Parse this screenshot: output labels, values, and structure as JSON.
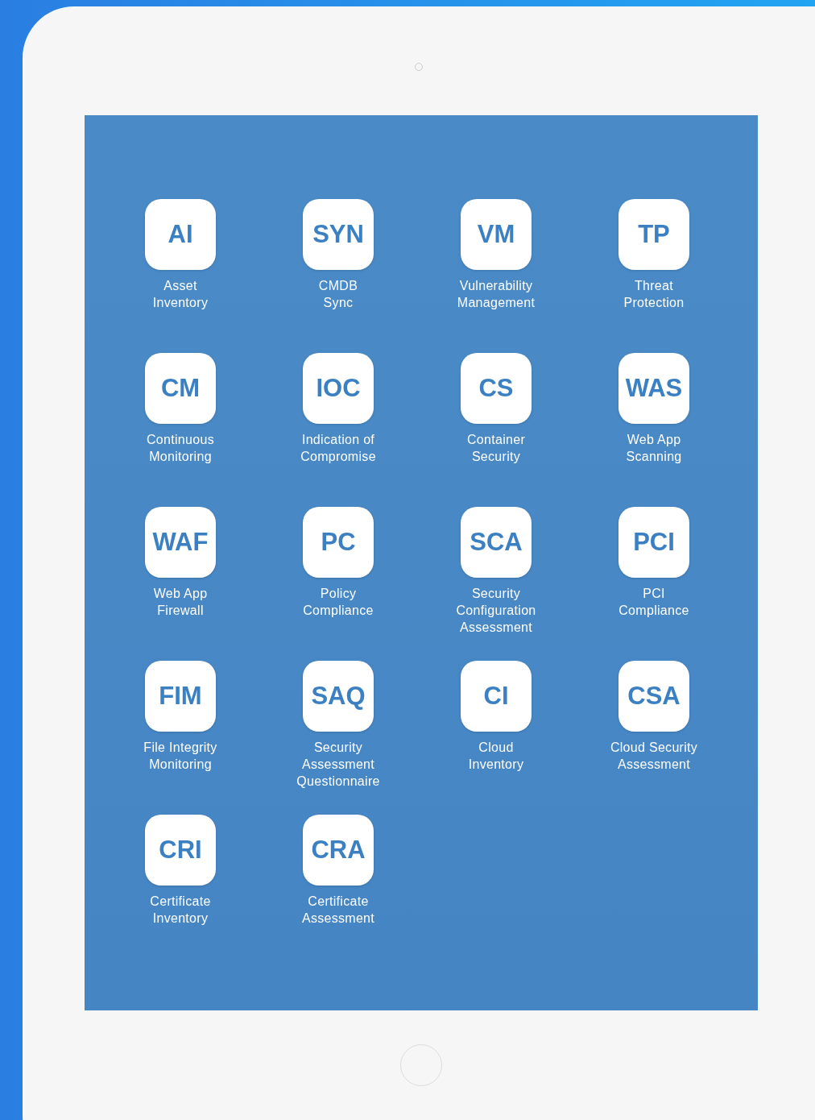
{
  "apps": [
    {
      "abbr": "AI",
      "label": "Asset\nInventory"
    },
    {
      "abbr": "SYN",
      "label": "CMDB\nSync"
    },
    {
      "abbr": "VM",
      "label": "Vulnerability\nManagement"
    },
    {
      "abbr": "TP",
      "label": "Threat\nProtection"
    },
    {
      "abbr": "CM",
      "label": "Continuous\nMonitoring"
    },
    {
      "abbr": "IOC",
      "label": "Indication of\nCompromise"
    },
    {
      "abbr": "CS",
      "label": "Container\nSecurity"
    },
    {
      "abbr": "WAS",
      "label": "Web App\nScanning"
    },
    {
      "abbr": "WAF",
      "label": "Web App\nFirewall"
    },
    {
      "abbr": "PC",
      "label": "Policy\nCompliance"
    },
    {
      "abbr": "SCA",
      "label": "Security\nConfiguration\nAssessment"
    },
    {
      "abbr": "PCI",
      "label": "PCI\nCompliance"
    },
    {
      "abbr": "FIM",
      "label": "File Integrity\nMonitoring"
    },
    {
      "abbr": "SAQ",
      "label": "Security\nAssessment\nQuestionnaire"
    },
    {
      "abbr": "CI",
      "label": "Cloud\nInventory"
    },
    {
      "abbr": "CSA",
      "label": "Cloud Security\nAssessment"
    },
    {
      "abbr": "CRI",
      "label": "Certificate\nInventory"
    },
    {
      "abbr": "CRA",
      "label": "Certificate\nAssessment"
    }
  ]
}
